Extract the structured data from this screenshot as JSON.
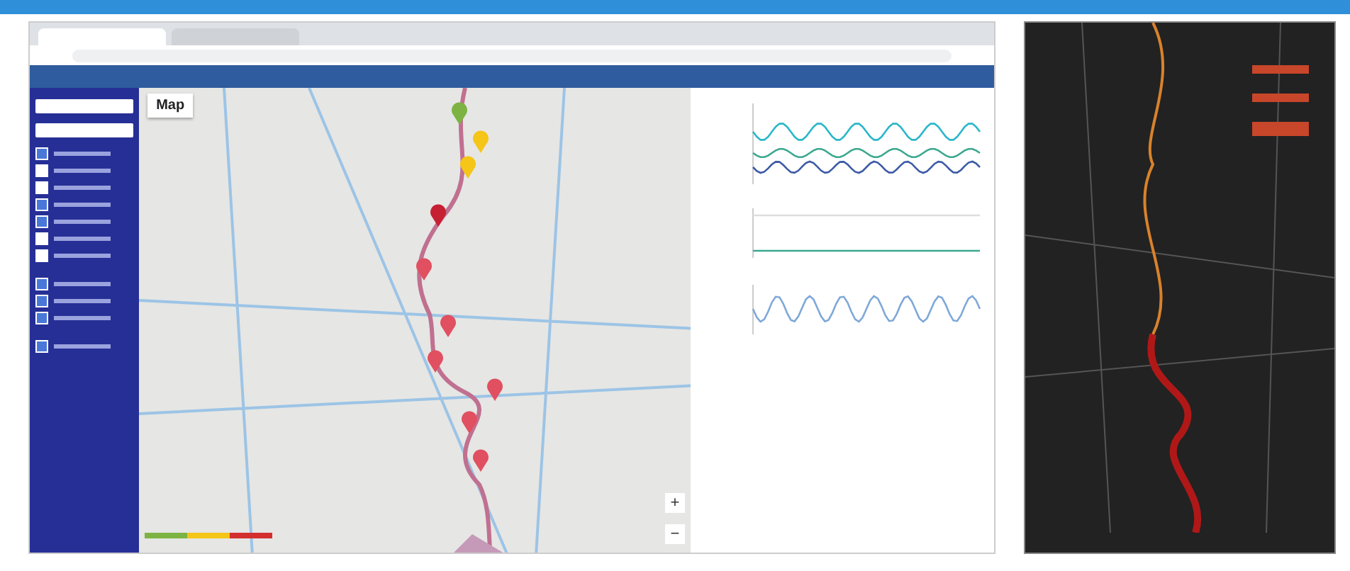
{
  "map_tabs": [
    {
      "label": "Map",
      "selected": true
    }
  ],
  "sidebar": {
    "checkboxes": [
      {
        "checked": true
      },
      {
        "checked": false
      },
      {
        "checked": false
      },
      {
        "checked": true
      },
      {
        "checked": true
      },
      {
        "checked": false
      },
      {
        "checked": false
      },
      {
        "checked": true
      },
      {
        "checked": true
      },
      {
        "checked": true
      },
      {
        "checked": true
      }
    ]
  },
  "markers": [
    {
      "color": "#7cb342"
    },
    {
      "color": "#f5c518"
    },
    {
      "color": "#f5c518"
    },
    {
      "color": "#c62033"
    },
    {
      "color": "#e05060"
    },
    {
      "color": "#e05060"
    },
    {
      "color": "#e05060"
    },
    {
      "color": "#e05060"
    },
    {
      "color": "#e05060"
    },
    {
      "color": "#e05060"
    }
  ],
  "map_legend": [
    {
      "color": "#7cb342"
    },
    {
      "color": "#f5c518"
    },
    {
      "color": "#d32f2f"
    }
  ],
  "map_controls": [
    {
      "label": "+"
    },
    {
      "label": "−"
    }
  ]
}
